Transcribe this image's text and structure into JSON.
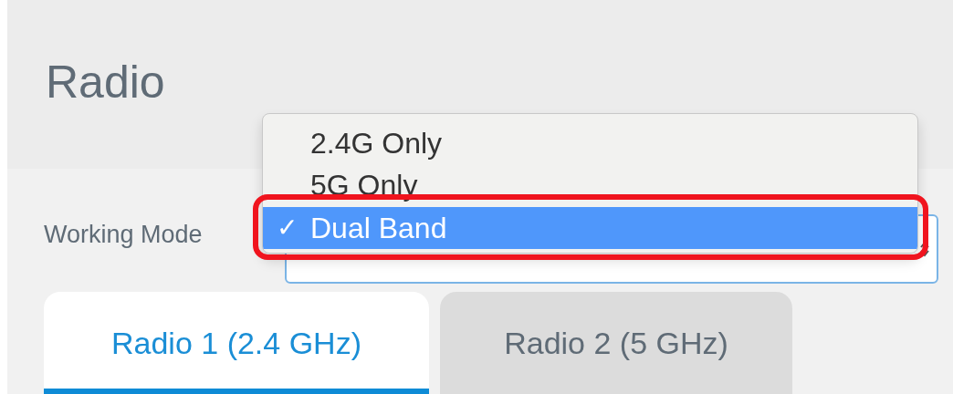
{
  "title": "Radio",
  "working_mode": {
    "label": "Working Mode",
    "options": [
      {
        "label": "2.4G Only",
        "selected": false
      },
      {
        "label": "5G Only",
        "selected": false
      },
      {
        "label": "Dual Band",
        "selected": true
      }
    ],
    "check": "✓"
  },
  "tabs": [
    {
      "label": "Radio 1 (2.4 GHz)",
      "selected": true
    },
    {
      "label": "Radio 2 (5 GHz)",
      "selected": false
    }
  ]
}
